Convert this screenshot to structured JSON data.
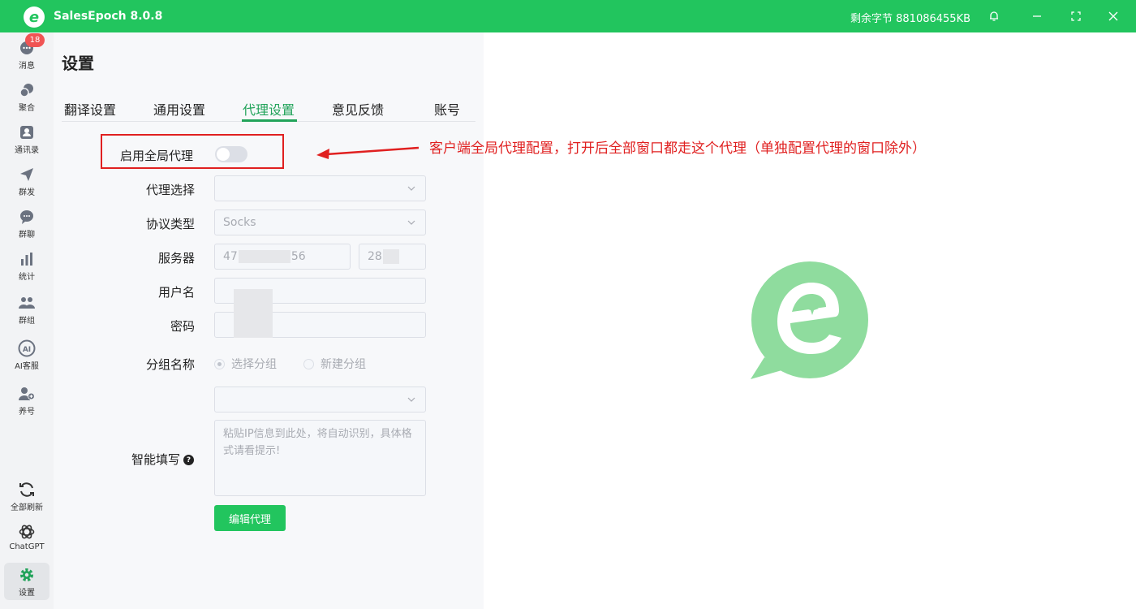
{
  "titlebar": {
    "app_name": "SalesEpoch 8.0.8",
    "remaining": "剩余字节 881086455KB",
    "logo_letter": "e"
  },
  "nav": {
    "badge": "18",
    "items": [
      {
        "label": "消息",
        "icon": "chat-bubble-icon"
      },
      {
        "label": "聚合",
        "icon": "aggregate-chat-icon"
      },
      {
        "label": "通讯录",
        "icon": "contacts-icon"
      },
      {
        "label": "群发",
        "icon": "send-icon"
      },
      {
        "label": "群聊",
        "icon": "group-chat-icon"
      },
      {
        "label": "统计",
        "icon": "bar-chart-icon"
      },
      {
        "label": "群组",
        "icon": "users-icon"
      },
      {
        "label": "AI客服",
        "icon": "ai-icon"
      },
      {
        "label": "养号",
        "icon": "user-plus-icon"
      },
      {
        "label": "全部刷新",
        "icon": "refresh-icon"
      },
      {
        "label": "ChatGPT",
        "icon": "chatgpt-icon"
      },
      {
        "label": "设置",
        "icon": "gear-icon"
      }
    ]
  },
  "settings": {
    "title": "设置",
    "tabs": [
      "翻译设置",
      "通用设置",
      "代理设置",
      "意见反馈",
      "账号"
    ],
    "active_tab": "代理设置",
    "form": {
      "global_proxy_label": "启用全局代理",
      "global_proxy_enabled": false,
      "proxy_select_label": "代理选择",
      "proxy_select_value": "",
      "protocol_label": "协议类型",
      "protocol_value": "Socks",
      "server_label": "服务器",
      "server_host_prefix": "47",
      "server_host_suffix": "56",
      "server_port_prefix": "28",
      "username_label": "用户名",
      "password_label": "密码",
      "group_label": "分组名称",
      "group_option_select": "选择分组",
      "group_option_new": "新建分组",
      "smart_fill_label": "智能填写",
      "smart_fill_placeholder": "粘贴IP信息到此处，将自动识别，具体格式请看提示!",
      "help_glyph": "?",
      "edit_button": "编辑代理"
    }
  },
  "annotation": "客户端全局代理配置，打开后全部窗口都走这个代理（单独配置代理的窗口除外）",
  "colors": {
    "brand": "#22c55e",
    "annotation": "#e02020",
    "active_tab": "#22a35a"
  }
}
